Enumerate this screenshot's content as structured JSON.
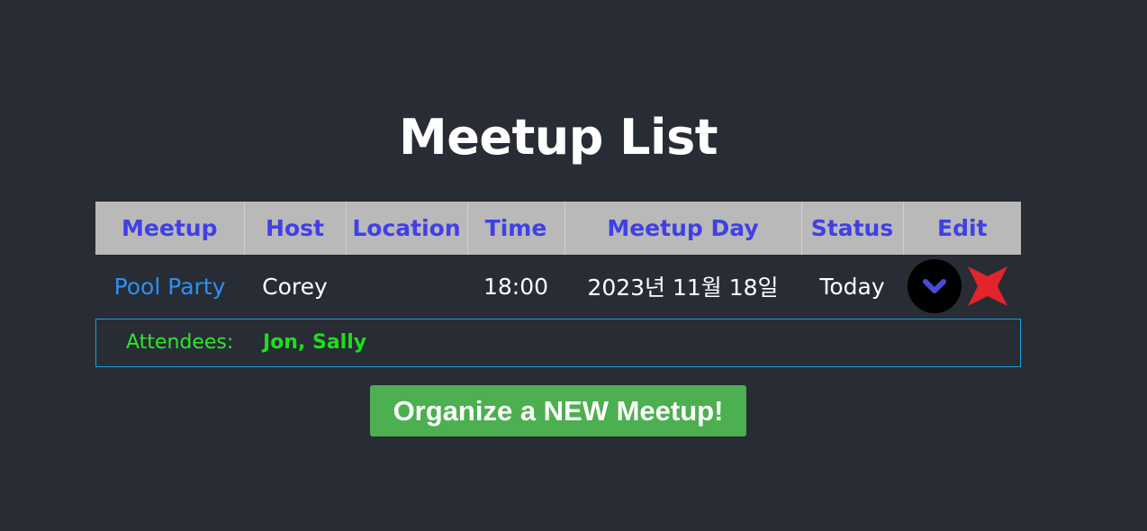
{
  "page": {
    "title": "Meetup List"
  },
  "table": {
    "headers": [
      "Meetup",
      "Host",
      "Location",
      "Time",
      "Meetup Day",
      "Status",
      "Edit"
    ],
    "rows": [
      {
        "meetup": "Pool Party",
        "host": "Corey",
        "location": "",
        "time": "18:00",
        "day": "2023년 11월 18일",
        "status": "Today",
        "edit_icons": [
          "chevron-down-icon",
          "close-icon"
        ]
      }
    ]
  },
  "attendees": {
    "label": "Attendees:",
    "names": "Jon, Sally"
  },
  "actions": {
    "organize_label": "Organize a NEW Meetup!"
  },
  "colors": {
    "background": "#282c34",
    "header_bg": "#b9b9b9",
    "header_text": "#4040e6",
    "link": "#2e8ff5",
    "attendees_green": "#2ee52e",
    "button_green": "#4caf50",
    "delete_red": "#e3242b",
    "border_blue": "#1e9bd7"
  }
}
